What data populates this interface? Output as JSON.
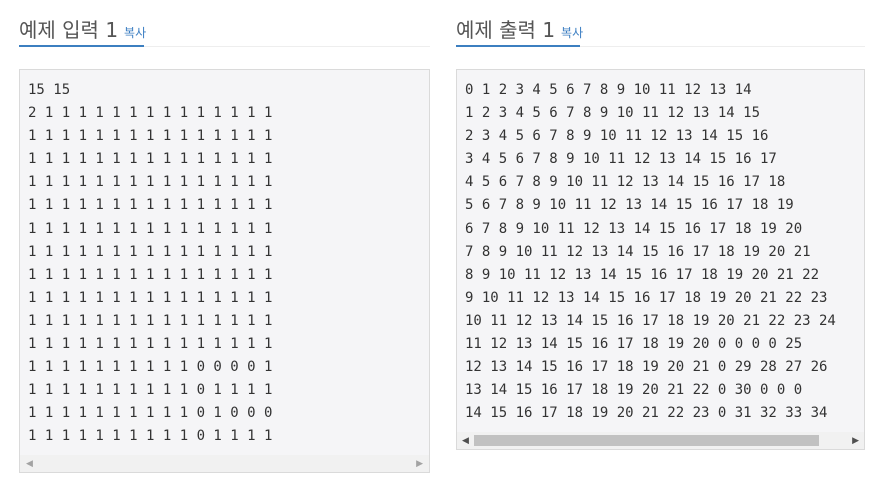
{
  "input": {
    "title": "예제 입력 1",
    "copy_label": "복사",
    "lines": [
      "15 15",
      "2 1 1 1 1 1 1 1 1 1 1 1 1 1 1",
      "1 1 1 1 1 1 1 1 1 1 1 1 1 1 1",
      "1 1 1 1 1 1 1 1 1 1 1 1 1 1 1",
      "1 1 1 1 1 1 1 1 1 1 1 1 1 1 1",
      "1 1 1 1 1 1 1 1 1 1 1 1 1 1 1",
      "1 1 1 1 1 1 1 1 1 1 1 1 1 1 1",
      "1 1 1 1 1 1 1 1 1 1 1 1 1 1 1",
      "1 1 1 1 1 1 1 1 1 1 1 1 1 1 1",
      "1 1 1 1 1 1 1 1 1 1 1 1 1 1 1",
      "1 1 1 1 1 1 1 1 1 1 1 1 1 1 1",
      "1 1 1 1 1 1 1 1 1 1 1 1 1 1 1",
      "1 1 1 1 1 1 1 1 1 1 0 0 0 0 1",
      "1 1 1 1 1 1 1 1 1 1 0 1 1 1 1",
      "1 1 1 1 1 1 1 1 1 1 0 1 0 0 0",
      "1 1 1 1 1 1 1 1 1 1 0 1 1 1 1"
    ]
  },
  "output": {
    "title": "예제 출력 1",
    "copy_label": "복사",
    "lines": [
      "0 1 2 3 4 5 6 7 8 9 10 11 12 13 14",
      "1 2 3 4 5 6 7 8 9 10 11 12 13 14 15",
      "2 3 4 5 6 7 8 9 10 11 12 13 14 15 16",
      "3 4 5 6 7 8 9 10 11 12 13 14 15 16 17",
      "4 5 6 7 8 9 10 11 12 13 14 15 16 17 18",
      "5 6 7 8 9 10 11 12 13 14 15 16 17 18 19",
      "6 7 8 9 10 11 12 13 14 15 16 17 18 19 20",
      "7 8 9 10 11 12 13 14 15 16 17 18 19 20 21",
      "8 9 10 11 12 13 14 15 16 17 18 19 20 21 22",
      "9 10 11 12 13 14 15 16 17 18 19 20 21 22 23",
      "10 11 12 13 14 15 16 17 18 19 20 21 22 23 24",
      "11 12 13 14 15 16 17 18 19 20 0 0 0 0 25",
      "12 13 14 15 16 17 18 19 20 21 0 29 28 27 26",
      "13 14 15 16 17 18 19 20 21 22 0 30 0 0 0",
      "14 15 16 17 18 19 20 21 22 23 0 31 32 33 34"
    ]
  },
  "icons": {
    "scroll_left": "◀",
    "scroll_right": "▶"
  }
}
